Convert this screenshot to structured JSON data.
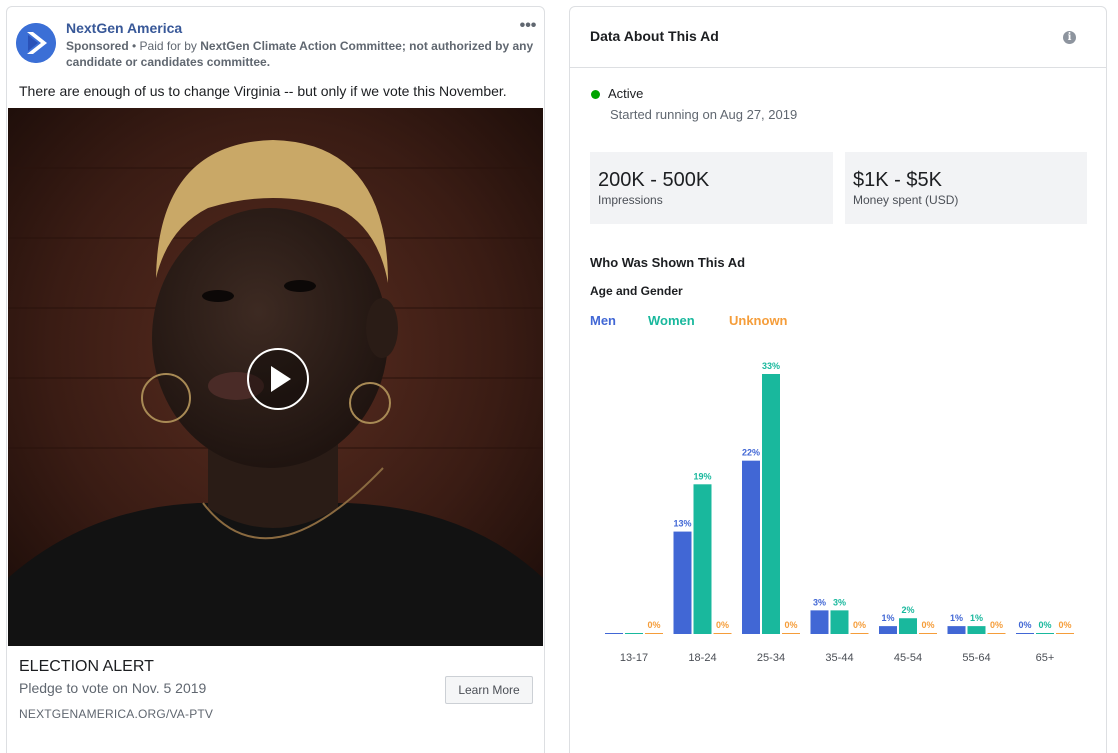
{
  "ad": {
    "page_name": "NextGen America",
    "sponsored_label": "Sponsored",
    "paid_for_prefix": " • Paid for by ",
    "paid_for_by": "NextGen Climate Action Committee; not authorized by any candidate or candidates committee.",
    "more_icon": "more-options-icon",
    "body_text": "There are enough of us to change Virginia -- but only if we vote this November.",
    "cta_title": "ELECTION ALERT",
    "cta_description": "Pledge to vote on Nov. 5 2019",
    "cta_url": "NEXTGENAMERICA.ORG/VA-PTV",
    "cta_button": "Learn More"
  },
  "panel": {
    "title": "Data About This Ad",
    "status": "Active",
    "status_color": "#00a400",
    "started": "Started running on Aug 27, 2019",
    "impressions_value": "200K - 500K",
    "impressions_label": "Impressions",
    "spend_value": "$1K - $5K",
    "spend_label": "Money spent (USD)",
    "section_title": "Who Was Shown This Ad",
    "subsection_title": "Age and Gender",
    "legend": {
      "men": "Men",
      "women": "Women",
      "unknown": "Unknown"
    }
  },
  "colors": {
    "men": "#4167d5",
    "women": "#19b89d",
    "unknown": "#f59d3a",
    "link": "#385898"
  },
  "chart_data": {
    "type": "bar",
    "categories": [
      "13-17",
      "18-24",
      "25-34",
      "35-44",
      "45-54",
      "55-64",
      "65+"
    ],
    "series": [
      {
        "name": "Men",
        "values": [
          0,
          13,
          22,
          3,
          1,
          1,
          0
        ],
        "labels": [
          "",
          "13%",
          "22%",
          "3%",
          "1%",
          "1%",
          "0%"
        ]
      },
      {
        "name": "Women",
        "values": [
          0,
          19,
          33,
          3,
          2,
          1,
          0
        ],
        "labels": [
          "",
          "19%",
          "33%",
          "3%",
          "2%",
          "1%",
          "0%"
        ]
      },
      {
        "name": "Unknown",
        "values": [
          0,
          0,
          0,
          0,
          0,
          0,
          0
        ],
        "labels": [
          "0%",
          "0%",
          "0%",
          "0%",
          "0%",
          "0%",
          "0%"
        ]
      }
    ],
    "ylim": [
      0,
      33
    ],
    "grid": false,
    "legend": "top-left"
  }
}
